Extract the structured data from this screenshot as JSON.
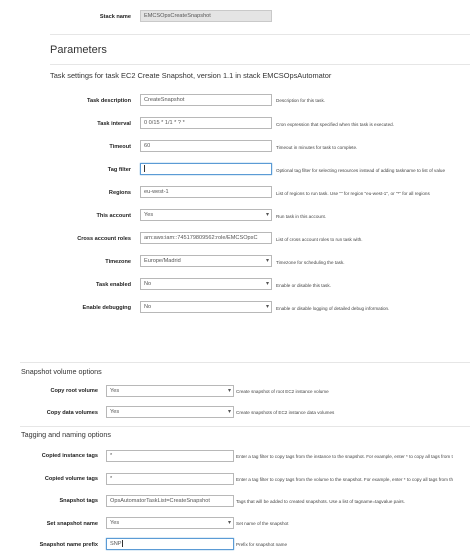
{
  "stack": {
    "label": "Stack name",
    "value": "EMCSOpsCreateSnapshot"
  },
  "parameters_title": "Parameters",
  "task_settings_title": "Task settings for task EC2 Create Snapshot, version 1.1 in stack EMCSOpsAutomator",
  "task_fields": [
    {
      "label": "Task description",
      "value": "CreateSnapshot",
      "desc": "Description for this task."
    },
    {
      "label": "Task interval",
      "value": "0 0/15 * 1/1 * ? *",
      "desc": "Cron expression that specified when this task is executed."
    },
    {
      "label": "Timeout",
      "value": "60",
      "desc": "Timeout in minutes for task to complete."
    },
    {
      "label": "Tag filter",
      "value": "",
      "desc": "Optional tag filter for selecting resources instead of adding taskname to list of value"
    },
    {
      "label": "Regions",
      "value": "eu-west-1",
      "desc": "List of regions to run task. Use \"\" for region \"eu-west-1\", or \"*\" for all regions"
    },
    {
      "label": "This account",
      "value": "Yes",
      "desc": "Run task in this account."
    },
    {
      "label": "Cross account roles",
      "value": "arn:aws:iam::745179809562:role/EMCSOpsC",
      "desc": "List of cross account roles to run task with."
    },
    {
      "label": "Timezone",
      "value": "Europe/Madrid",
      "desc": "Timezone for scheduling the task."
    },
    {
      "label": "Task enabled",
      "value": "No",
      "desc": "Enable or disable this task."
    },
    {
      "label": "Enable debugging",
      "value": "No",
      "desc": "Enable or disable logging of detailed debug information."
    }
  ],
  "snapshot_title": "Snapshot volume options",
  "snapshot_fields": [
    {
      "label": "Copy root volume",
      "value": "Yes",
      "desc": "Create snapshot of root EC2 instance volume"
    },
    {
      "label": "Copy data volumes",
      "value": "Yes",
      "desc": "Create snapshots of EC2 instance data volumes"
    }
  ],
  "tagging_title": "Tagging and naming options",
  "tagging_fields": [
    {
      "label": "Copied instance tags",
      "value": "*",
      "desc": "Enter a tag filter to copy tags from the instance to the snapshot. For example, enter * to copy all tags from t"
    },
    {
      "label": "Copied volume tags",
      "value": "*",
      "desc": "Enter a tag filter to copy tags from the volume to the snapshot. For example, enter * to copy all tags from th"
    },
    {
      "label": "Snapshot tags",
      "value": "OpsAutomatorTaskList=CreateSnapshot",
      "desc": "Tags that will be added to created snapshots. Use a list of tagname=tagvalue pairs."
    },
    {
      "label": "Set snapshot name",
      "value": "Yes",
      "desc": "Set name of the snapshot"
    },
    {
      "label": "Snapshot name prefix",
      "value": "SNP",
      "desc": "Prefix for snapshot name"
    }
  ]
}
